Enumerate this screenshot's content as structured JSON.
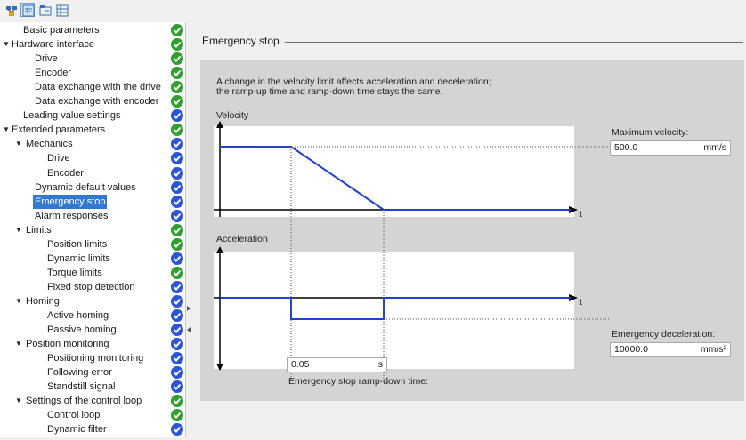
{
  "toolbar": {
    "buttons": [
      {
        "icon": "overview-icon"
      },
      {
        "icon": "parameter-view-icon"
      },
      {
        "icon": "function-view-icon"
      },
      {
        "icon": "table-view-icon"
      }
    ]
  },
  "tree": {
    "items": [
      {
        "label": "Basic parameters",
        "status": "ok"
      },
      {
        "label": "Hardware interface",
        "status": "ok",
        "expanded": true
      },
      {
        "label": "Drive",
        "status": "ok"
      },
      {
        "label": "Encoder",
        "status": "ok"
      },
      {
        "label": "Data exchange with the drive",
        "status": "ok"
      },
      {
        "label": "Data exchange with encoder",
        "status": "ok"
      },
      {
        "label": "Leading value settings",
        "status": "default"
      },
      {
        "label": "Extended parameters",
        "status": "ok",
        "expanded": true
      },
      {
        "label": "Mechanics",
        "status": "default",
        "expanded": true
      },
      {
        "label": "Drive",
        "status": "default"
      },
      {
        "label": "Encoder",
        "status": "default"
      },
      {
        "label": "Dynamic default values",
        "status": "default"
      },
      {
        "label": "Emergency stop",
        "status": "default",
        "selected": true
      },
      {
        "label": "Alarm responses",
        "status": "default"
      },
      {
        "label": "Limits",
        "status": "ok",
        "expanded": true
      },
      {
        "label": "Position limits",
        "status": "ok"
      },
      {
        "label": "Dynamic limits",
        "status": "default"
      },
      {
        "label": "Torque limits",
        "status": "ok"
      },
      {
        "label": "Fixed stop detection",
        "status": "default"
      },
      {
        "label": "Homing",
        "status": "default",
        "expanded": true
      },
      {
        "label": "Active homing",
        "status": "default"
      },
      {
        "label": "Passive homing",
        "status": "default"
      },
      {
        "label": "Position monitoring",
        "status": "default",
        "expanded": true
      },
      {
        "label": "Positioning monitoring",
        "status": "default"
      },
      {
        "label": "Following error",
        "status": "default"
      },
      {
        "label": "Standstill signal",
        "status": "default"
      },
      {
        "label": "Settings of the control loop",
        "status": "ok",
        "expanded": true
      },
      {
        "label": "Control loop",
        "status": "ok"
      },
      {
        "label": "Dynamic filter",
        "status": "default"
      }
    ]
  },
  "main": {
    "section_title": "Emergency stop",
    "description_line1": "A change in the velocity limit affects acceleration and deceleration;",
    "description_line2": "the ramp-up time and ramp-down time stays the same.",
    "velocity_label": "Velocity",
    "acceleration_label": "Acceleration",
    "time_axis_label": "t",
    "max_velocity": {
      "label": "Maximum velocity:",
      "value": "500.0",
      "unit": "mm/s"
    },
    "emergency_deceleration": {
      "label": "Emergency deceleration:",
      "value": "10000.0",
      "unit": "mm/s²"
    },
    "ramp_down_time": {
      "label": "Emergency stop ramp-down time:",
      "value": "0.05",
      "unit": "s"
    }
  },
  "colors": {
    "accent": "#3078d0",
    "curve": "#1f3fd6",
    "status_ok": "#2ea02e",
    "status_default": "#2a55d6",
    "panel": "#d4d4d4"
  }
}
